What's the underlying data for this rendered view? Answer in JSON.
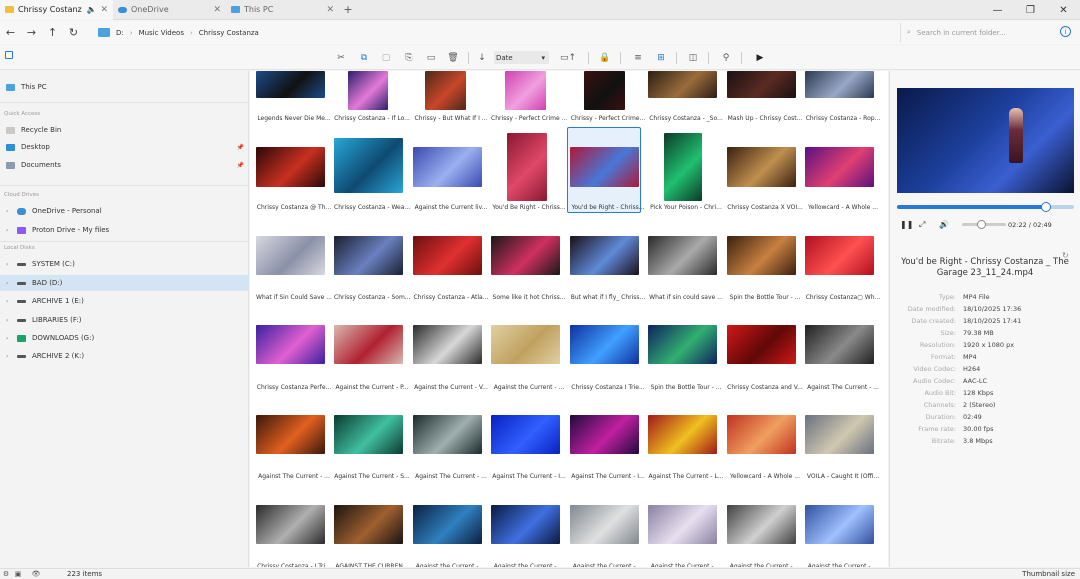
{
  "tabs": [
    {
      "label": "Chrissy Costanza",
      "icon": "folder-icon",
      "active": true
    },
    {
      "label": "OneDrive",
      "icon": "cloud-icon",
      "active": false
    },
    {
      "label": "This PC",
      "icon": "computer-icon",
      "active": false
    }
  ],
  "address": {
    "segments": [
      "D:",
      "Music Videos",
      "Chrissy Costanza"
    ],
    "search_placeholder": "Search in current folder..."
  },
  "toolbar": {
    "sort_label": "Date"
  },
  "sidebar": {
    "this_pc": "This PC",
    "quick_access_head": "Quick Access",
    "quick_access": [
      "Recycle Bin",
      "Desktop",
      "Documents"
    ],
    "cloud_head": "Cloud Drives",
    "cloud": [
      "OneDrive - Personal",
      "Proton Drive - My files"
    ],
    "local_head": "Local Disks",
    "disks": [
      "SYSTEM (C:)",
      "BAD (D:)",
      "ARCHIVE 1 (E:)",
      "LIBRARIES (F:)",
      "DOWNLOADS (G:)",
      "ARCHIVE 2 (K:)"
    ]
  },
  "files": [
    "Legends Never Die Me...",
    "Chrissy Costanza - If Lo...",
    "Chrissy - But What If I ...",
    "Chrissy - Perfect Crime ...",
    "Chrissy - Perfect Crime...",
    "Chrissy Costanza - _So...",
    "Mash Up - Chrissy Cost...",
    "Chrissy Costanza - Rop...",
    "Chrissy Costanza @ Th...",
    "Chrissy Costanza - Wea...",
    "Against the Current liv...",
    "You'd Be Right - Chriss...",
    "You'd be Right - Chriss...",
    "Pick Your Poison - Chri...",
    "Chrissy Costanza X VOI...",
    "Yellowcard - A Whole ...",
    "What if Sin Could Save ...",
    "Chrissy Costanza - Som...",
    "Chrissy Costanza - Atla...",
    "Some like it hot Chriss...",
    "But what if I fly_ Chriss...",
    "What if sin could save ...",
    "Spin the Bottle Tour - ...",
    "Chrissy Costanza▢ Wh...",
    "Chrissy Costanza Perfe...",
    "Against the Current - P...",
    "Against the Current - V...",
    "Against the Current - ...",
    "Chrissy Costanza I Trie...",
    "Spin the Bottle Tour - ...",
    "Chrissy Costanza and V...",
    "Against The Current - ...",
    "Against The Current - ...",
    "Against The Current - S...",
    "Against The Current - ...",
    "Against The Current - I...",
    "Against The Current - I...",
    "Against The Current - L...",
    "Yellowcard - A Whole ...",
    "VOILÀ - Caught It (Offi...",
    "Chrissy Costanza - I Tri...",
    "AGAINST THE CURREN...",
    "Against the Current - ...",
    "Against the Current - ...",
    "Against the Current - ...",
    "Against the Current - ...",
    "Against the Current - ...",
    "Against the Current - ..."
  ],
  "colors": {
    "accent": "#2a79d4",
    "selection_bg": "#d5e4f3"
  },
  "preview": {
    "time": "02:22 / 02:49",
    "progress": 0.84,
    "filename": "You'd be Right - Chrissy Costanza _ The Garage 23_11_24.mp4",
    "properties": [
      {
        "k": "Type:",
        "v": "MP4 File"
      },
      {
        "k": "Date modified:",
        "v": "18/10/2025 17:36"
      },
      {
        "k": "Date created:",
        "v": "18/10/2025 17:41"
      },
      {
        "k": "Size:",
        "v": "79.38 MB"
      },
      {
        "k": "Resolution:",
        "v": "1920 x 1080 px"
      },
      {
        "k": "Format:",
        "v": "MP4"
      },
      {
        "k": "Video Codec:",
        "v": "H264"
      },
      {
        "k": "Audio Codec:",
        "v": "AAC-LC"
      },
      {
        "k": "Audio Bit:",
        "v": "128 Kbps"
      },
      {
        "k": "Channels:",
        "v": "2 (Stereo)"
      },
      {
        "k": "Duration:",
        "v": "02:49"
      },
      {
        "k": "Frame rate:",
        "v": "30.00 fps"
      },
      {
        "k": "Bitrate:",
        "v": "3.8 Mbps"
      }
    ]
  },
  "status": {
    "count": "223 items",
    "view_mode": "Thumbnail size"
  }
}
